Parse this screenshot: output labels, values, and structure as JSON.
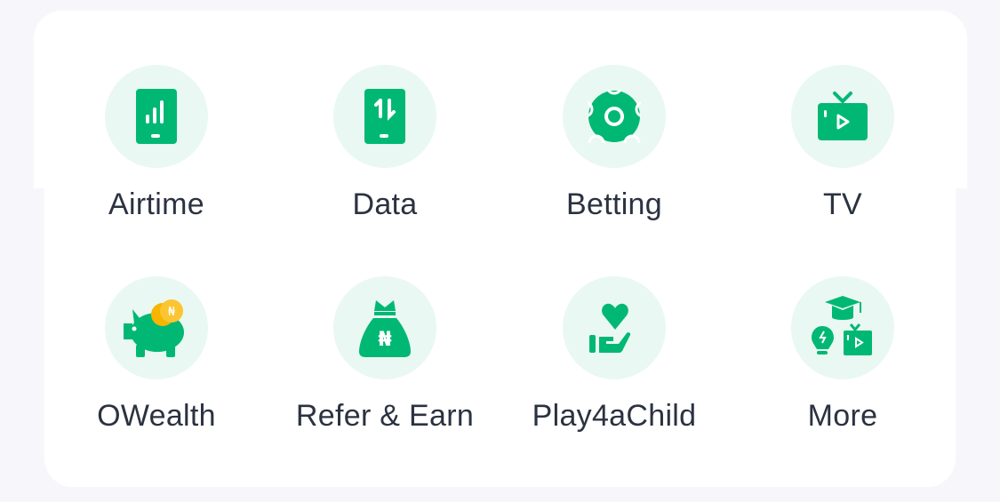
{
  "colors": {
    "accent": "#00b874",
    "icon_bg": "#e9f8f2",
    "text": "#2b3240",
    "coin": "#f7b500"
  },
  "services": [
    {
      "label": "Airtime",
      "icon": "phone-signal-icon"
    },
    {
      "label": "Data",
      "icon": "phone-data-icon"
    },
    {
      "label": "Betting",
      "icon": "soccer-ball-icon"
    },
    {
      "label": "TV",
      "icon": "tv-icon"
    },
    {
      "label": "OWealth",
      "icon": "piggy-bank-icon"
    },
    {
      "label": "Refer & Earn",
      "icon": "money-bag-icon"
    },
    {
      "label": "Play4aChild",
      "icon": "heart-hand-icon"
    },
    {
      "label": "More",
      "icon": "more-services-icon"
    }
  ]
}
